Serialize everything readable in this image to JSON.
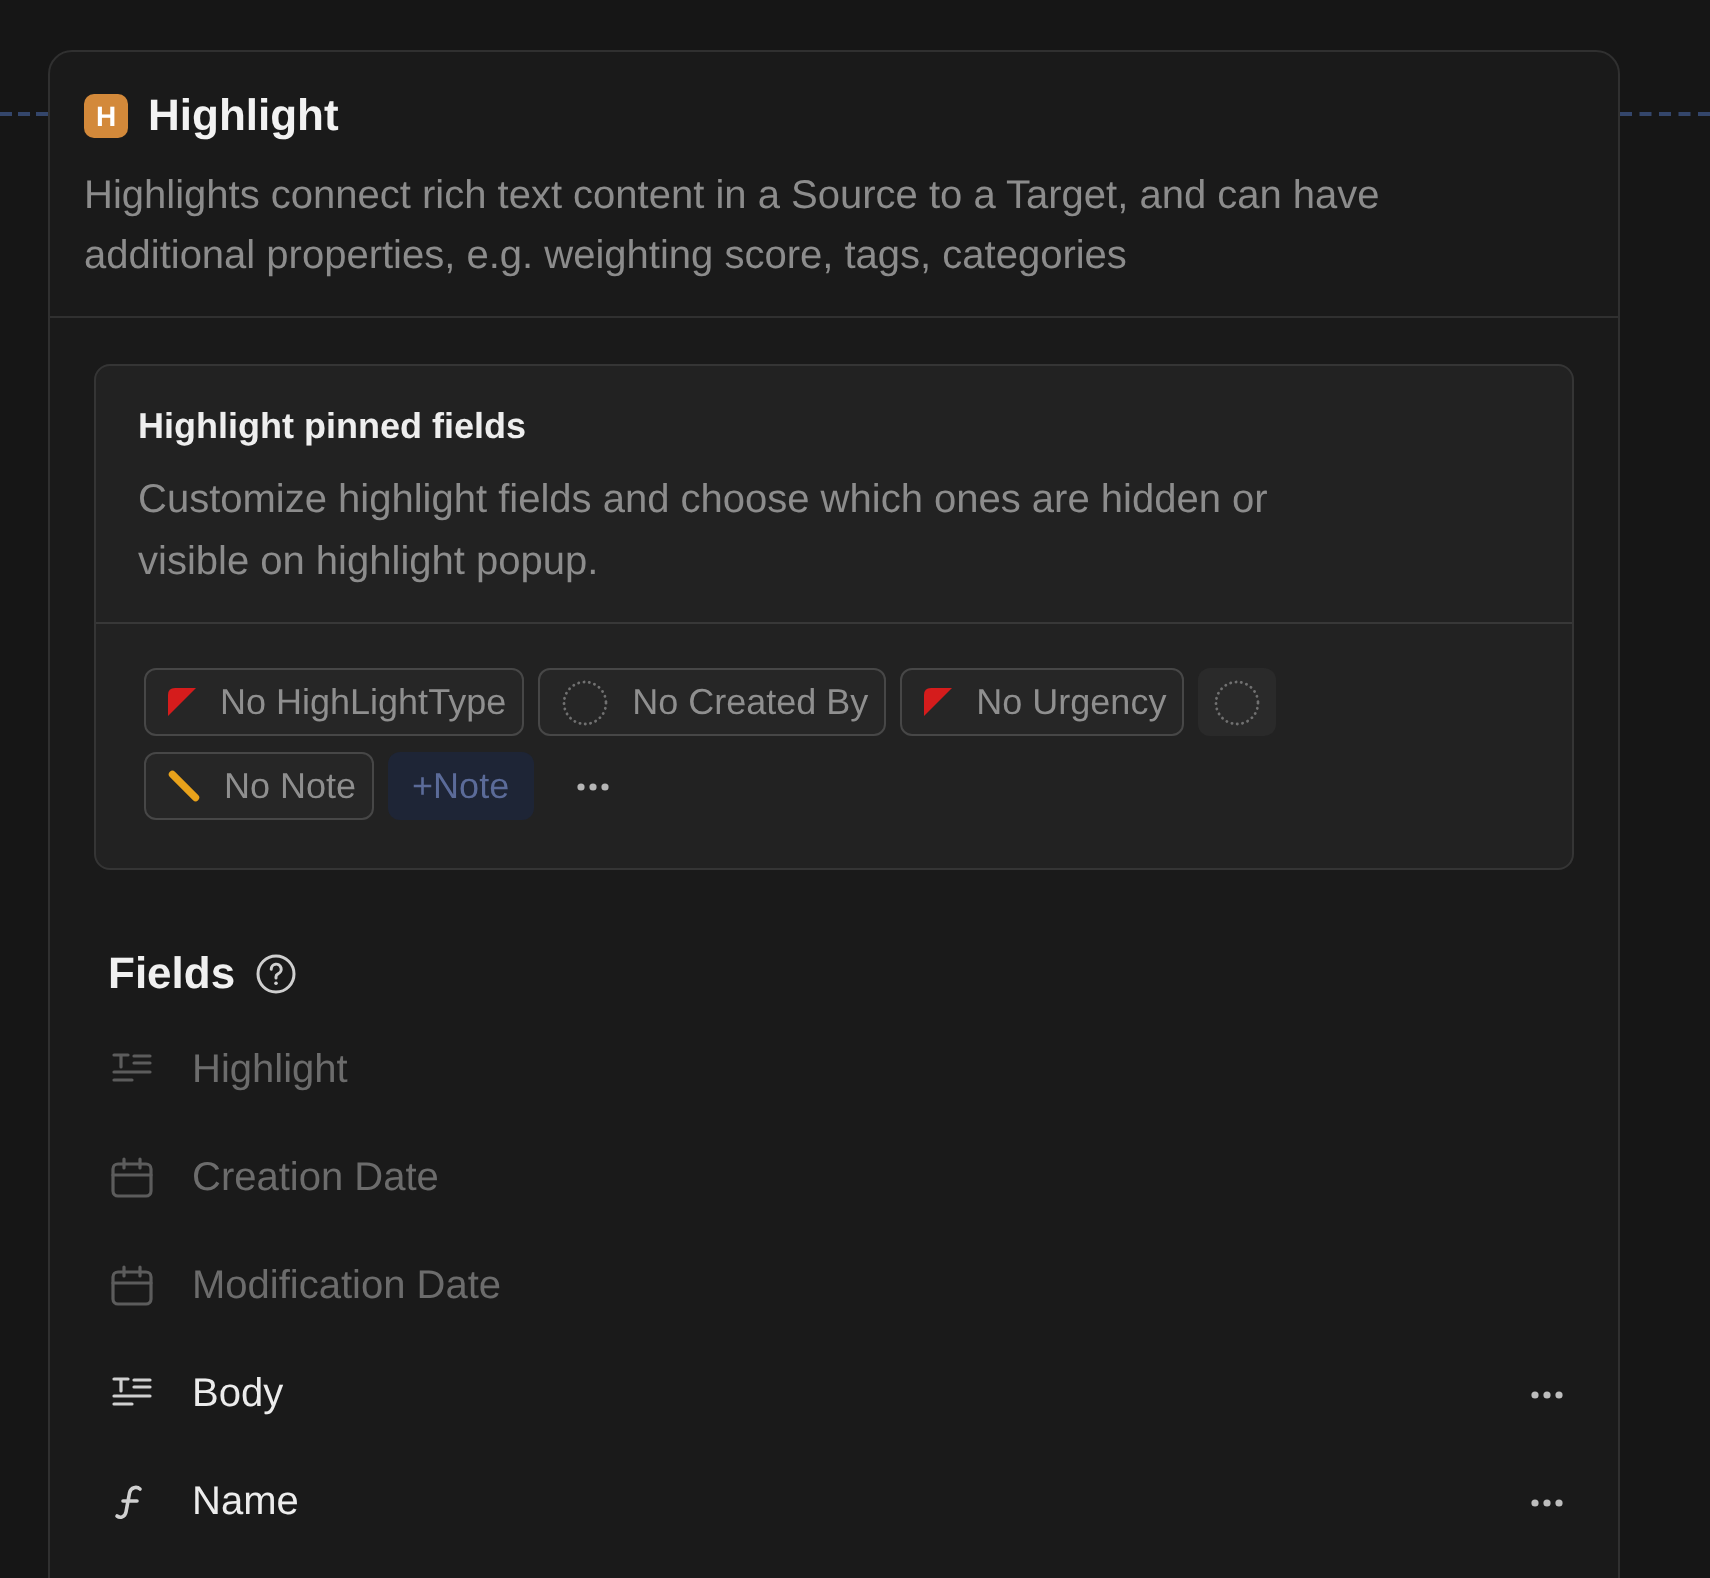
{
  "header": {
    "badge": "H",
    "title": "Highlight",
    "description": "Highlights connect rich text content in a Source to a Target, and can have additional properties, e.g. weighting score, tags, categories"
  },
  "pinned_fields": {
    "title": "Highlight pinned fields",
    "description": "Customize highlight fields and choose which ones are hidden or visible on highlight popup.",
    "chips": [
      {
        "kind": "flag",
        "label": "No HighLightType"
      },
      {
        "kind": "person",
        "label": "No Created By"
      },
      {
        "kind": "flag",
        "label": "No Urgency"
      },
      {
        "kind": "avatar"
      },
      {
        "kind": "note",
        "label": "No Note"
      },
      {
        "kind": "add",
        "label": "+Note"
      },
      {
        "kind": "more"
      }
    ]
  },
  "fields": {
    "title": "Fields",
    "items": [
      {
        "kind": "text",
        "label": "Highlight",
        "disabled": true
      },
      {
        "kind": "date",
        "label": "Creation Date",
        "disabled": true
      },
      {
        "kind": "date",
        "label": "Modification Date",
        "disabled": true
      },
      {
        "kind": "text",
        "label": "Body",
        "disabled": false
      },
      {
        "kind": "formula",
        "label": "Name",
        "disabled": false
      }
    ]
  }
}
